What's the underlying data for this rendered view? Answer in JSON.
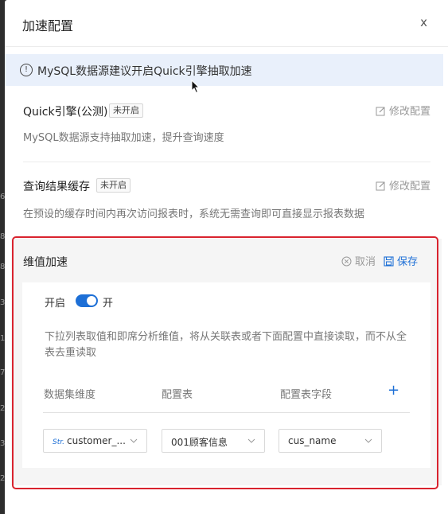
{
  "backdrop": {
    "numbers": [
      "6",
      "8",
      "8",
      "3",
      "1",
      "7",
      "2",
      "3",
      "2"
    ]
  },
  "dialog": {
    "title": "加速配置",
    "close_label": "x"
  },
  "notice": {
    "icon_char": "!",
    "text": "MySQL数据源建议开启Quick引擎抽取加速"
  },
  "quick_engine": {
    "title": "Quick引擎(公测)",
    "badge": "未开启",
    "edit_label": "修改配置",
    "description": "MySQL数据源支持抽取加速，提升查询速度"
  },
  "query_cache": {
    "title": "查询结果缓存",
    "badge": "未开启",
    "edit_label": "修改配置",
    "description": "在预设的缓存时间内再次访问报表时，系统无需查询即可直接显示报表数据"
  },
  "dim_accel": {
    "title": "维值加速",
    "cancel_label": "取消",
    "save_label": "保存",
    "enable_label": "开启",
    "switch_state_label": "开",
    "help_text": "下拉列表取值和即席分析维值，将从关联表或者下面配置中直接读取，而不从全表去重读取",
    "columns": {
      "dimension": "数据集维度",
      "config_table": "配置表",
      "config_field": "配置表字段"
    },
    "add_label": "+",
    "row": {
      "dimension_type": "Str.",
      "dimension_value": "customer_...",
      "table_value": "001顾客信息",
      "field_value": "cus_name"
    }
  },
  "colors": {
    "accent": "#1d6fd6",
    "highlight_border": "#d9232e",
    "notice_bg": "#e9f0fb"
  }
}
